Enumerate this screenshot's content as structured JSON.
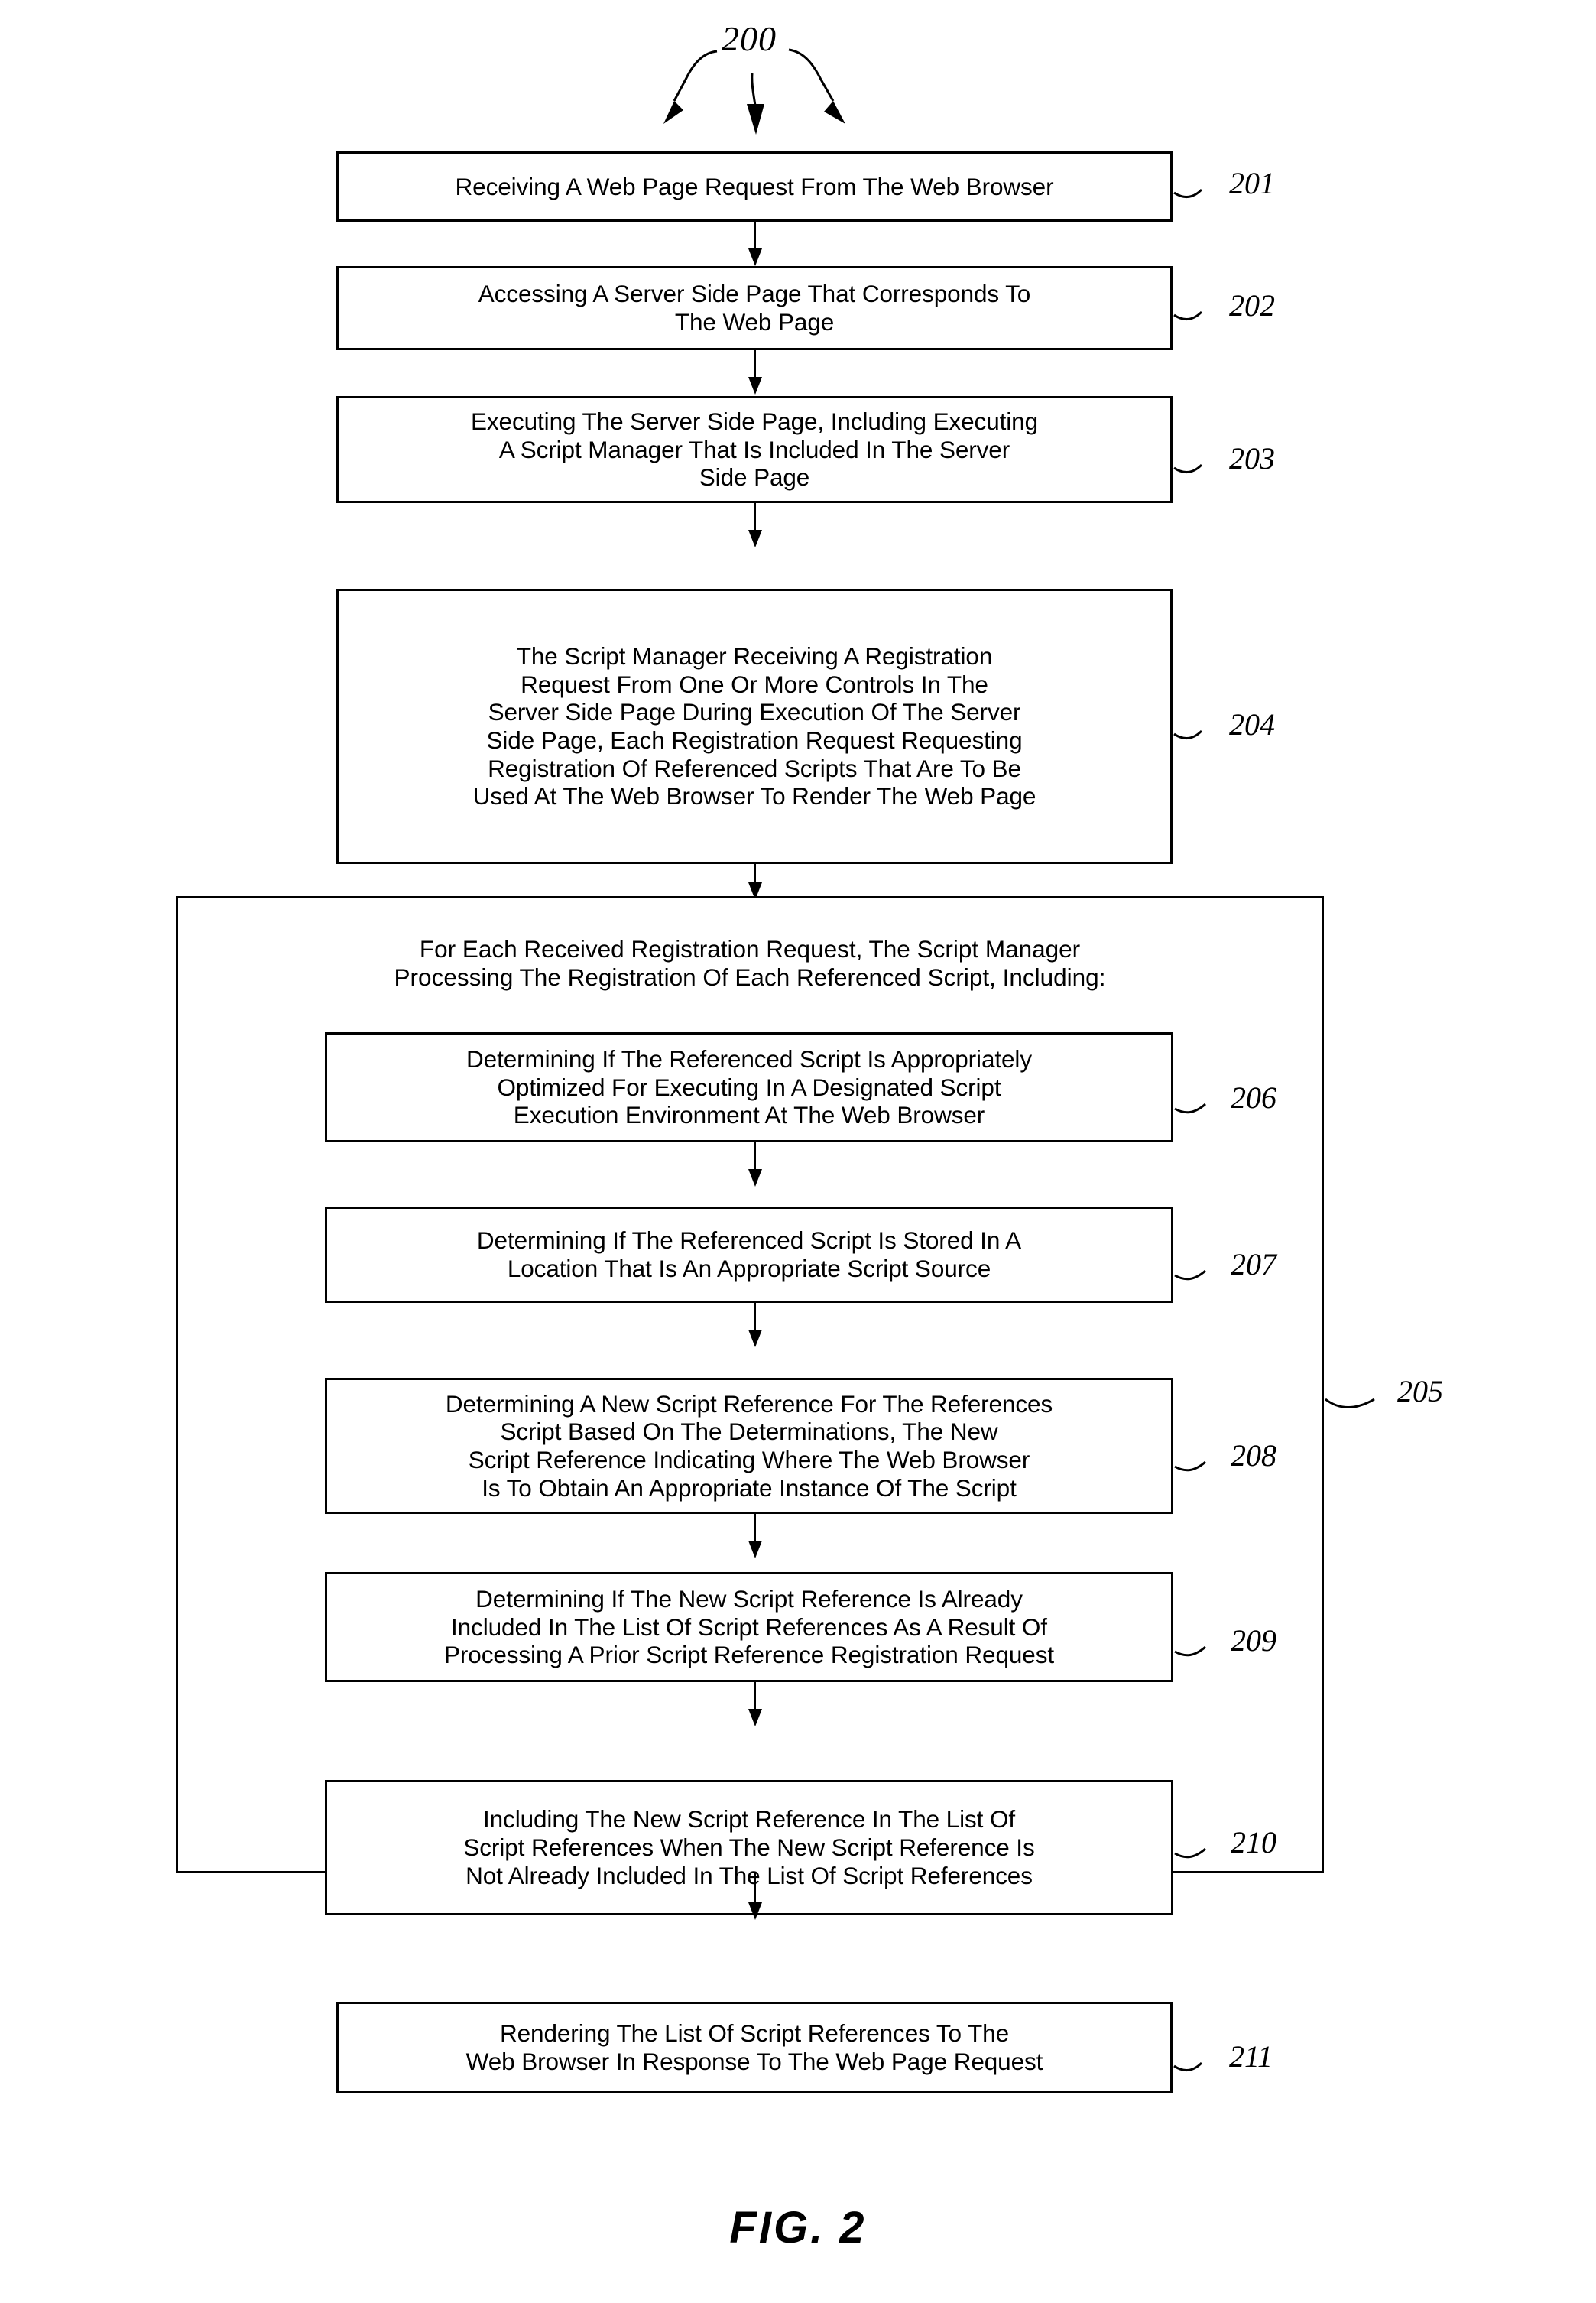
{
  "figure": {
    "caption": "FIG. 2",
    "diagram_ref": "200"
  },
  "flowchart": {
    "type": "flowchart",
    "orientation": "top-to-bottom",
    "steps": [
      {
        "ref": "201",
        "text": "Receiving A Web Page Request From The Web Browser"
      },
      {
        "ref": "202",
        "text": "Accessing A Server Side Page That Corresponds To\nThe Web Page"
      },
      {
        "ref": "203",
        "text": "Executing The Server Side Page, Including Executing\nA Script Manager That Is Included In The Server\nSide Page"
      },
      {
        "ref": "204",
        "text": "The Script Manager Receiving A Registration\nRequest From  One Or More Controls In The\nServer Side Page During Execution Of The Server\nSide Page, Each Registration Request Requesting\nRegistration Of Referenced Scripts That Are To Be\nUsed At The Web Browser To Render The Web Page"
      }
    ],
    "group": {
      "ref": "205",
      "header": "For Each Received Registration Request, The Script Manager\nProcessing The Registration Of Each Referenced Script, Including:",
      "substeps": [
        {
          "ref": "206",
          "text": "Determining If The Referenced Script Is Appropriately\nOptimized For Executing In A Designated Script\nExecution Environment At The Web Browser"
        },
        {
          "ref": "207",
          "text": "Determining If The Referenced Script Is Stored In A\nLocation That Is An Appropriate Script Source"
        },
        {
          "ref": "208",
          "text": "Determining A New Script Reference For The References\nScript Based On The Determinations, The New\nScript Reference Indicating Where The Web Browser\nIs To Obtain An Appropriate Instance Of The Script"
        },
        {
          "ref": "209",
          "text": "Determining If The New Script Reference Is Already\nIncluded In The List Of Script References As A Result Of\nProcessing A Prior Script Reference Registration Request"
        },
        {
          "ref": "210",
          "text": "Including The New Script Reference In The List Of\nScript References When The New Script Reference Is\nNot Already Included In The List Of Script References"
        }
      ]
    },
    "final_step": {
      "ref": "211",
      "text": "Rendering The List Of Script References To The\nWeb Browser In Response To The Web Page Request"
    }
  }
}
